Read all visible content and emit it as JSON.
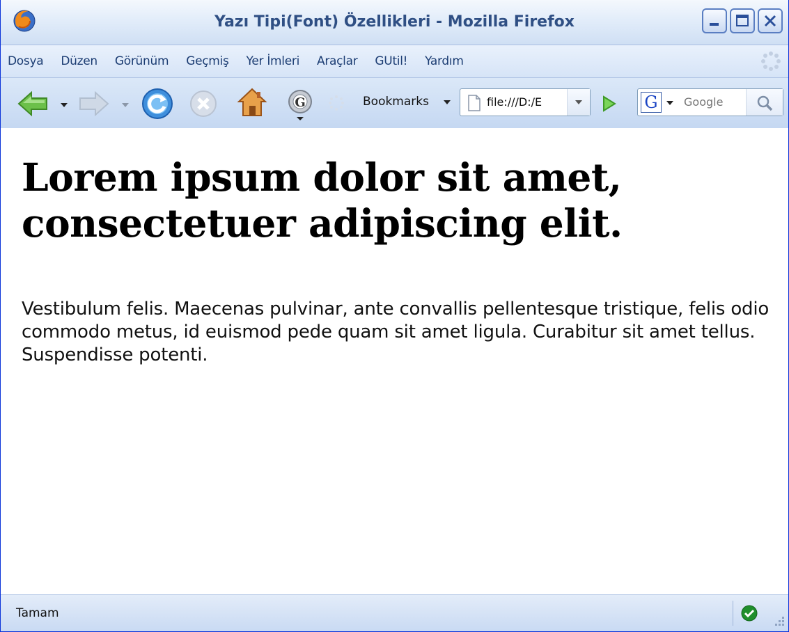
{
  "window": {
    "title": "Yazı Tipi(Font) Özellikleri - Mozilla Firefox"
  },
  "menu": {
    "items": [
      "Dosya",
      "Düzen",
      "Görünüm",
      "Geçmiş",
      "Yer İmleri",
      "Araçlar",
      "GUtil!",
      "Yardım"
    ]
  },
  "toolbar": {
    "bookmarks_label": "Bookmarks",
    "url": "file:///D:/E",
    "search_placeholder": "Google"
  },
  "page": {
    "heading": "Lorem ipsum dolor sit amet, consectetuer adipiscing elit.",
    "paragraph": "Vestibulum felis. Maecenas pulvinar, ante convallis pellentesque tristique, felis odio commodo metus, id euismod pede quam sit amet ligula. Curabitur sit amet tellus. Suspendisse potenti."
  },
  "status": {
    "text": "Tamam"
  },
  "colors": {
    "titlebar_text": "#2f4f84",
    "menu_text": "#1c3d73",
    "chrome_blue": "#c5d8f2"
  },
  "icons": {
    "app": "firefox-icon",
    "back": "back-arrow-icon",
    "forward": "forward-arrow-icon",
    "reload": "reload-icon",
    "stop": "stop-icon",
    "home": "home-icon",
    "gutil": "gear-g-icon",
    "go": "go-arrow-icon",
    "search": "magnifier-icon",
    "secure": "check-circle-icon"
  }
}
